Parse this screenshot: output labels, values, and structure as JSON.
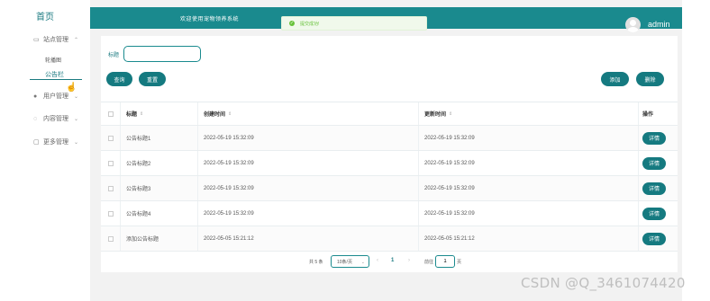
{
  "sidebar": {
    "brand": "首页",
    "items": [
      {
        "label": "站点管理",
        "icon": "monitor-icon"
      },
      {
        "label": "用户管理",
        "icon": "user-icon"
      },
      {
        "label": "内容管理",
        "icon": "comment-icon"
      },
      {
        "label": "更多管理",
        "icon": "chat-icon"
      }
    ],
    "sub_items": [
      {
        "label": "轮播图"
      },
      {
        "label": "公告栏",
        "active": true
      }
    ]
  },
  "header": {
    "title": "欢迎使用宠物领养系统",
    "username": "admin"
  },
  "toast": {
    "message": "提交成功!"
  },
  "filter": {
    "label": "标题",
    "value": "",
    "placeholder": ""
  },
  "toolbar": {
    "query_label": "查询",
    "reset_label": "重置",
    "add_label": "添加",
    "delete_label": "删除"
  },
  "table": {
    "columns": [
      "标题",
      "创建时间",
      "更新时间",
      "操作"
    ],
    "rows": [
      {
        "title": "公告标题1",
        "created": "2022-05-19 15:32:09",
        "updated": "2022-05-19 15:32:09",
        "action": "详情"
      },
      {
        "title": "公告标题2",
        "created": "2022-05-19 15:32:09",
        "updated": "2022-05-19 15:32:09",
        "action": "详情"
      },
      {
        "title": "公告标题3",
        "created": "2022-05-19 15:32:09",
        "updated": "2022-05-19 15:32:09",
        "action": "详情"
      },
      {
        "title": "公告标题4",
        "created": "2022-05-19 15:32:09",
        "updated": "2022-05-19 15:32:09",
        "action": "详情"
      },
      {
        "title": "添加公告标题",
        "created": "2022-05-05 15:21:12",
        "updated": "2022-05-05 15:21:12",
        "action": "详情"
      }
    ]
  },
  "pagination": {
    "total": "共 5 条",
    "page_size": "10条/页",
    "current_page": "1",
    "goto_prefix": "前往",
    "goto_value": "1",
    "goto_suffix": "页"
  },
  "watermark": "CSDN @Q_3461074420",
  "colors": {
    "accent": "#1a8a8e",
    "button": "#157a80",
    "toast_bg": "#f0f9eb",
    "toast_text": "#67c23a"
  }
}
